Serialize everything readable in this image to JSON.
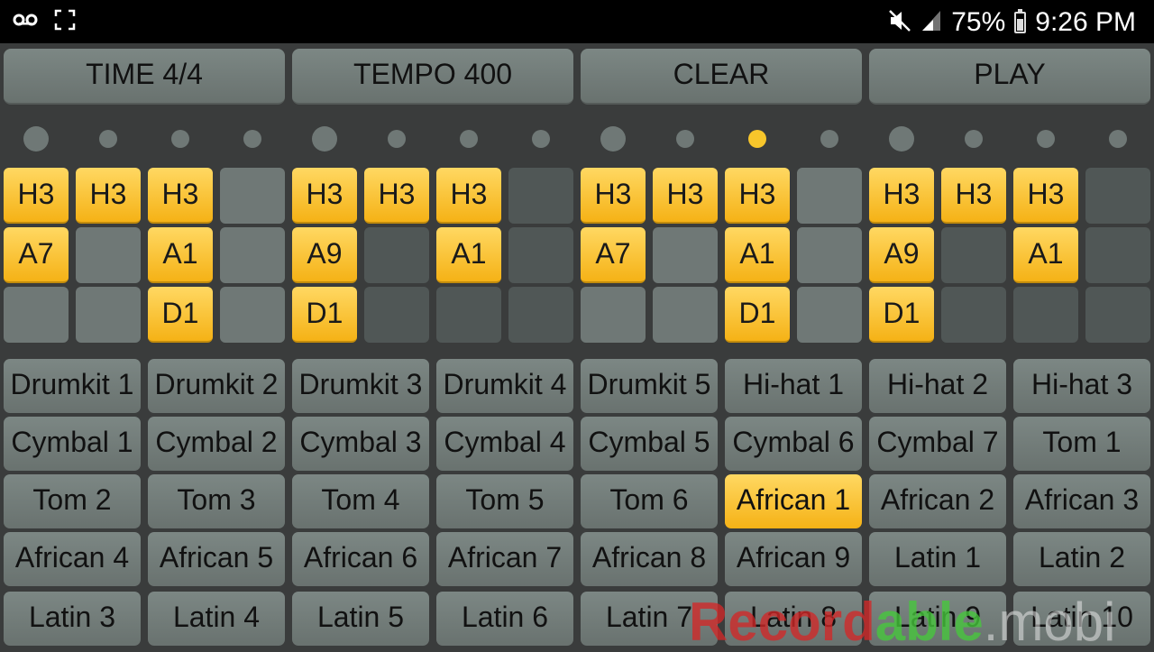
{
  "status_bar": {
    "left_icons": [
      "voicemail-icon",
      "screen-capture-icon"
    ],
    "mute_icon": "volume-mute-icon",
    "signal_icon": "signal-icon",
    "battery_percent": "75%",
    "battery_level": 0.75,
    "time": "9:26 PM"
  },
  "top_buttons": [
    "TIME 4/4",
    "TEMPO 400",
    "CLEAR",
    "PLAY"
  ],
  "beat_indicator": {
    "total": 16,
    "active_index": 10,
    "accent_every": 4
  },
  "step_grid": {
    "columns": 16,
    "rows": [
      [
        "H3",
        "H3",
        "H3",
        "",
        "H3",
        "H3",
        "H3",
        "",
        "H3",
        "H3",
        "H3",
        "",
        "H3",
        "H3",
        "H3",
        ""
      ],
      [
        "A7",
        "",
        "A1",
        "",
        "A9",
        "",
        "A1",
        "",
        "A7",
        "",
        "A1",
        "",
        "A9",
        "",
        "A1",
        ""
      ],
      [
        "",
        "",
        "D1",
        "",
        "D1",
        "",
        "",
        "",
        "",
        "",
        "D1",
        "",
        "D1",
        "",
        "",
        ""
      ]
    ]
  },
  "instruments": [
    "Drumkit 1",
    "Drumkit 2",
    "Drumkit 3",
    "Drumkit 4",
    "Drumkit 5",
    "Hi-hat 1",
    "Hi-hat 2",
    "Hi-hat 3",
    "Cymbal 1",
    "Cymbal 2",
    "Cymbal 3",
    "Cymbal 4",
    "Cymbal 5",
    "Cymbal 6",
    "Cymbal 7",
    "Tom 1",
    "Tom 2",
    "Tom 3",
    "Tom 4",
    "Tom 5",
    "Tom 6",
    "African 1",
    "African 2",
    "African 3",
    "African 4",
    "African 5",
    "African 6",
    "African 7",
    "African 8",
    "African 9",
    "Latin 1",
    "Latin 2",
    "Latin 3",
    "Latin 4",
    "Latin 5",
    "Latin 6",
    "Latin 7",
    "Latin 8",
    "Latin 9",
    "Latin 10"
  ],
  "selected_instrument": "African 1",
  "watermark": {
    "part1": "Record",
    "part2": "able",
    "part3": ".mobi"
  },
  "colors": {
    "accent": "#f7c62b",
    "pad_light": "#6f7876",
    "pad_dark": "#505756",
    "background": "#3a3c3c"
  }
}
